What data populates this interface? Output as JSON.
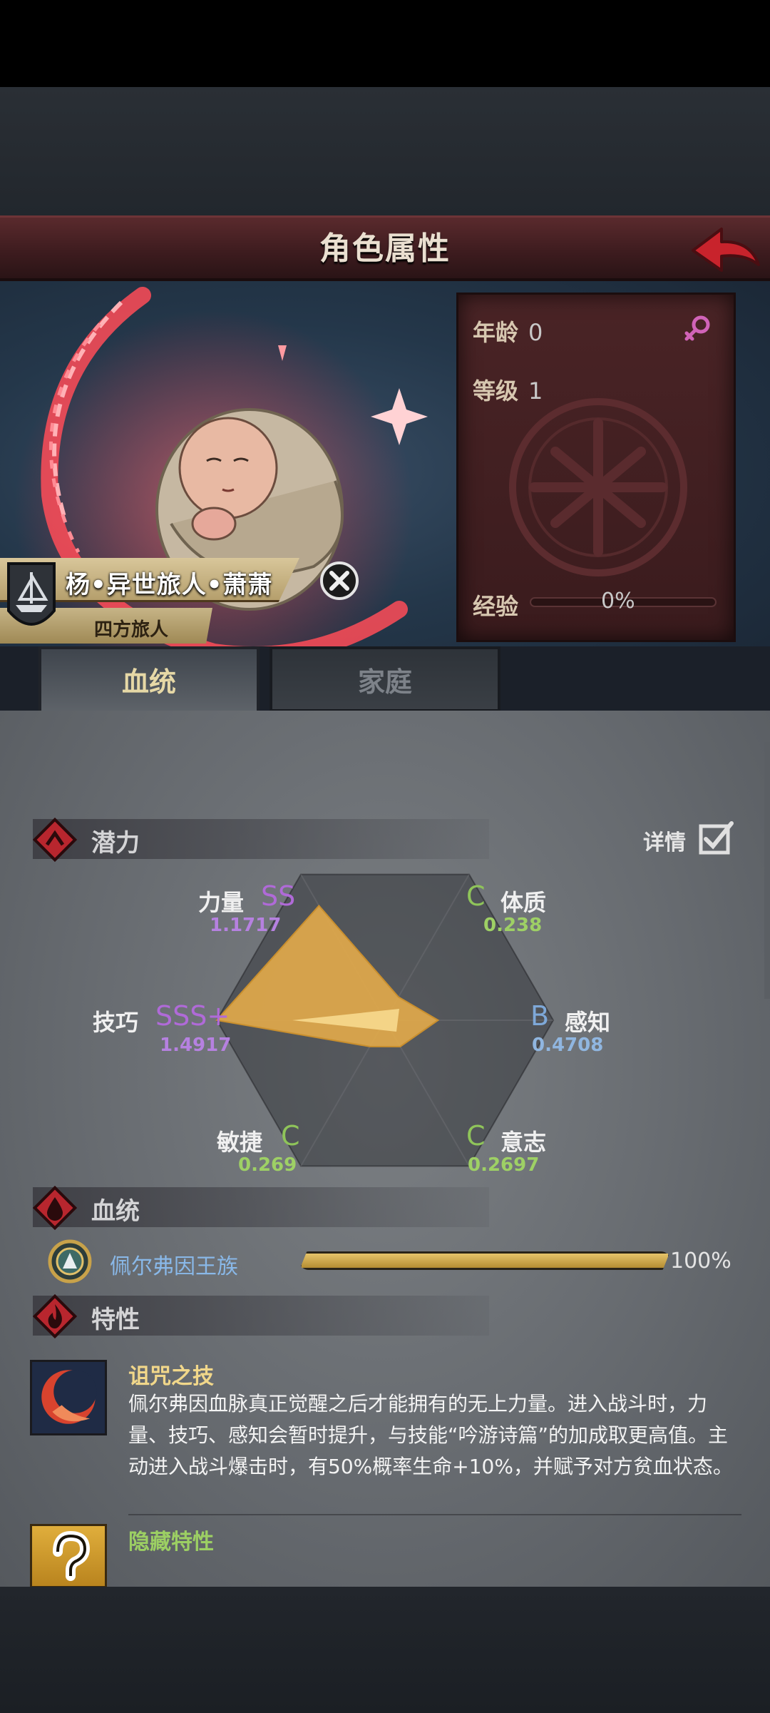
{
  "header": {
    "title": "角色属性"
  },
  "character": {
    "name": "杨•异世旅人•萧萧",
    "title": "四方旅人"
  },
  "info": {
    "age_label": "年龄",
    "age_value": "0",
    "level_label": "等级",
    "level_value": "1",
    "exp_label": "经验",
    "exp_value": "0%",
    "exp_fraction": 0
  },
  "tabs": [
    {
      "label": "血统",
      "active": true
    },
    {
      "label": "家庭",
      "active": false
    }
  ],
  "potential": {
    "title": "潜力",
    "detail_label": "详情",
    "detail_checked": true
  },
  "chart_data": {
    "type": "radar",
    "axes": [
      {
        "name": "力量",
        "grade": "SS",
        "value": 1.1717,
        "display": "1.1717"
      },
      {
        "name": "体质",
        "grade": "C",
        "value": 0.238,
        "display": "0.238"
      },
      {
        "name": "感知",
        "grade": "B",
        "value": 0.4708,
        "display": "0.4708"
      },
      {
        "name": "意志",
        "grade": "C",
        "value": 0.2697,
        "display": "0.2697"
      },
      {
        "name": "敏捷",
        "grade": "C",
        "value": 0.269,
        "display": "0.269"
      },
      {
        "name": "技巧",
        "grade": "SSS+",
        "value": 1.4917,
        "display": "1.4917"
      }
    ],
    "max": 1.4917
  },
  "grade_colors": {
    "SS": "#b06ad8",
    "SSS+": "#b06ad8",
    "B": "#7ea8d8",
    "C": "#8fc45a"
  },
  "value_colors": {
    "SS": "#b681e0",
    "SSS+": "#b681e0",
    "B": "#90b6e0",
    "C": "#9ed065"
  },
  "bloodline": {
    "title": "血统",
    "name": "佩尔弗因王族",
    "percent": "100%",
    "fraction": 1.0
  },
  "traits": {
    "title": "特性",
    "items": [
      {
        "name": "诅咒之技",
        "description": "佩尔弗因血脉真正觉醒之后才能拥有的无上力量。进入战斗时，力量、技巧、感知会暂时提升，与技能“吟游诗篇”的加成取更高值。主动进入战斗爆击时，有50%概率生命+10%，并赋予对方贫血状态。"
      }
    ],
    "hidden_title": "隐藏特性"
  },
  "icons": {
    "back": "back-arrow-icon",
    "gender": "female-icon",
    "crest": "ship-crest-icon",
    "close": "close-icon",
    "potential": "potential-icon",
    "bloodline": "blood-drop-icon",
    "trait": "flame-icon",
    "bloodline_emblem": "laurel-emblem-icon",
    "curse_skill": "crescent-flame-icon",
    "hidden": "question-mark-icon"
  },
  "colors": {
    "radar_fill": "#e3ab4a",
    "accent_red": "#c8333b"
  }
}
